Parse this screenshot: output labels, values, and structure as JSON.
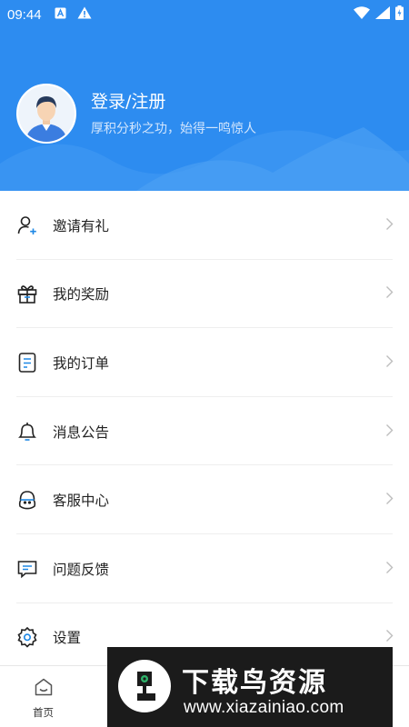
{
  "status_bar": {
    "time": "09:44"
  },
  "profile": {
    "title": "登录/注册",
    "subtitle": "厚积分秒之功，始得一鸣惊人"
  },
  "menu": [
    {
      "label": "邀请有礼",
      "icon": "user-plus-icon"
    },
    {
      "label": "我的奖励",
      "icon": "gift-icon"
    },
    {
      "label": "我的订单",
      "icon": "order-icon"
    },
    {
      "label": "消息公告",
      "icon": "bell-icon"
    },
    {
      "label": "客服中心",
      "icon": "headset-icon"
    },
    {
      "label": "问题反馈",
      "icon": "feedback-icon"
    },
    {
      "label": "设置",
      "icon": "gear-icon"
    }
  ],
  "tabbar": {
    "home_label": "首页"
  },
  "watermark": {
    "title": "下载鸟资源",
    "url": "www.xiazainiao.com"
  },
  "colors": {
    "brand_blue": "#2d8cf0",
    "accent_blue": "#1e88e5"
  }
}
